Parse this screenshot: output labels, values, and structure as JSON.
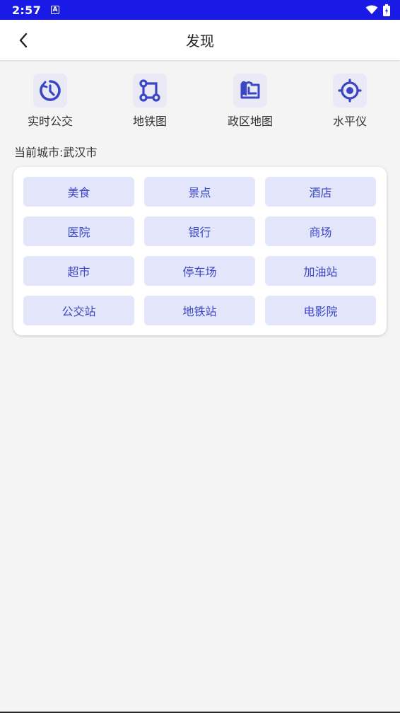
{
  "status": {
    "time": "2:57",
    "indicator": "A"
  },
  "appbar": {
    "title": "发现"
  },
  "tools": [
    {
      "label": "实时公交",
      "icon": "realtime-bus-icon"
    },
    {
      "label": "地铁图",
      "icon": "metro-map-icon"
    },
    {
      "label": "政区地图",
      "icon": "political-map-icon"
    },
    {
      "label": "水平仪",
      "icon": "level-icon"
    }
  ],
  "city": {
    "label": "当前城市:武汉市"
  },
  "categories": [
    "美食",
    "景点",
    "酒店",
    "医院",
    "银行",
    "商场",
    "超市",
    "停车场",
    "加油站",
    "公交站",
    "地铁站",
    "电影院"
  ],
  "colors": {
    "statusbar": "#1a1ae6",
    "accent": "#3b46c4",
    "chip_bg": "#e3e6fb",
    "icon_bg": "#eaeaf6"
  }
}
